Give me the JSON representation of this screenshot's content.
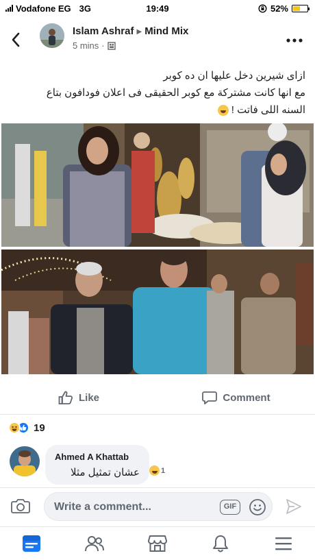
{
  "status_bar": {
    "carrier": "Vodafone EG",
    "network": "3G",
    "time": "19:49",
    "battery": "52%",
    "battery_level": 0.52
  },
  "post": {
    "author": "Islam Ashraf",
    "group": "Mind Mix",
    "time_ago": "5 mins",
    "text_lines": [
      "ازاى شيرين دخل عليها ان ده كوبر",
      "مع انها كانت مشتركة مع كوبر الحقيقى فى اعلان فودافون بتاع",
      "السنه اللى فاتت !"
    ],
    "icons": {
      "back": "back-chevron-icon",
      "more": "more-dots-icon",
      "audience": "audience-icon"
    }
  },
  "actions": {
    "like_label": "Like",
    "comment_label": "Comment"
  },
  "reactions": {
    "count": "19",
    "types": [
      "haha",
      "like"
    ]
  },
  "comment": {
    "author": "Ahmed A Khattab",
    "text": "عشان تمثيل مثلا",
    "reaction_count": "1"
  },
  "composer": {
    "placeholder": "Write a comment...",
    "gif_label": "GIF"
  },
  "bottom_nav": {
    "items": [
      "news-feed-icon",
      "groups-icon",
      "marketplace-icon",
      "notifications-icon",
      "menu-icon"
    ],
    "active": "news-feed-icon"
  },
  "colors": {
    "facebook_blue": "#1877f2",
    "text_primary": "#1c1e21",
    "text_secondary": "#65676b",
    "battery_yellow": "#f5c518"
  }
}
